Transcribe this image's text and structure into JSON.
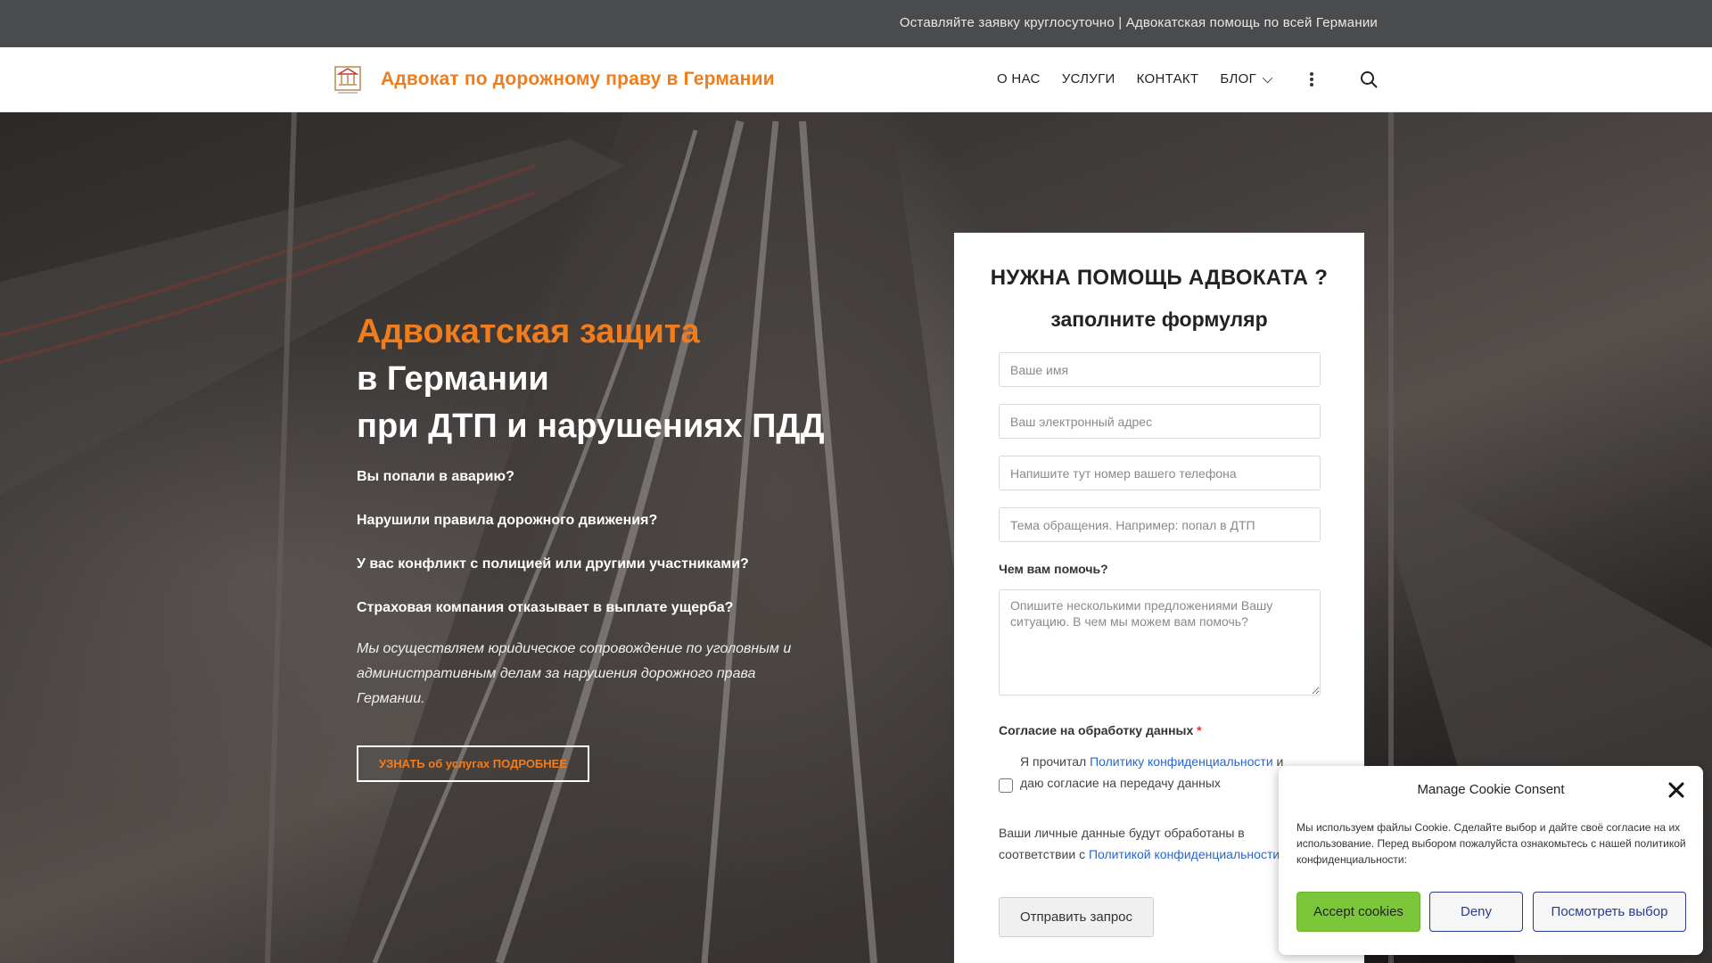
{
  "topbar": {
    "message": "Оставляйте заявку круглосуточно  | Адвокатская помощь по всей Германии"
  },
  "header": {
    "logo_icon": "law-firm-logo-icon",
    "site_title": "Адвокат по дорожному праву в Германии",
    "nav": [
      {
        "label": "О НАС"
      },
      {
        "label": "УСЛУГИ"
      },
      {
        "label": "КОНТАКТ"
      },
      {
        "label": "БЛОГ"
      }
    ],
    "more_icon": "vertical-dots-icon",
    "search_icon": "search-icon"
  },
  "hero": {
    "title_line1": "Адвокатская защита",
    "title_line2": "в Германии",
    "title_line3": "при ДТП и нарушениях ПДД",
    "questions": [
      "Вы попали в аварию?",
      "Нарушили правила дорожного движения?",
      "У вас конфликт с полицией или другими участниками?",
      "Страховая компания отказывает в выплате ущерба?"
    ],
    "description": "Мы осуществляем юридическое сопровождение по уголовным и административным делам за нарушения дорожного права Германии.",
    "cta_label": "УЗНАТЬ об услугах ПОДРОБНЕЕ"
  },
  "form": {
    "title": "НУЖНА ПОМОЩЬ АДВОКАТА ?",
    "subtitle": "заполните формуляр",
    "name_placeholder": "Ваше имя",
    "email_placeholder": "Ваш электронный адрес",
    "phone_placeholder": "Напишите тут номер вашего телефона",
    "subject_placeholder": "Тема обращения. Например: попал в ДТП",
    "help_label": "Чем вам помочь?",
    "message_placeholder": "Опишите несколькими предложениями Вашу ситуацию. В чем мы можем вам помочь?",
    "consent_label": "Согласие на обработку данных",
    "required_mark": "*",
    "consent_text_before": "Я прочитал ",
    "consent_link": "Политику конфиденциальности",
    "consent_text_after": " и даю согласие на передачу данных",
    "note_before": "Ваши личные данные будут обработаны в соответствии с ",
    "note_link": "Политикой конфиденциальности",
    "note_after": ".",
    "submit_label": "Отправить запрос"
  },
  "cookie": {
    "title": "Manage Cookie Consent",
    "text": "Мы используем файлы Cookie. Сделайте выбор и дайте своё согласие на их использование. Перед выбором пожалуйста ознакомьтесь с нашей политикой конфиденциальности:",
    "accept_label": "Accept cookies",
    "deny_label": "Deny",
    "view_label": "Посмотреть выбор",
    "close_icon": "close-icon"
  },
  "colors": {
    "accent": "#f07d1d",
    "topbar": "#4a4b4d",
    "link": "#2a66c9",
    "accept": "#7cc63a",
    "cookie_button_border": "#2a3a8f"
  }
}
